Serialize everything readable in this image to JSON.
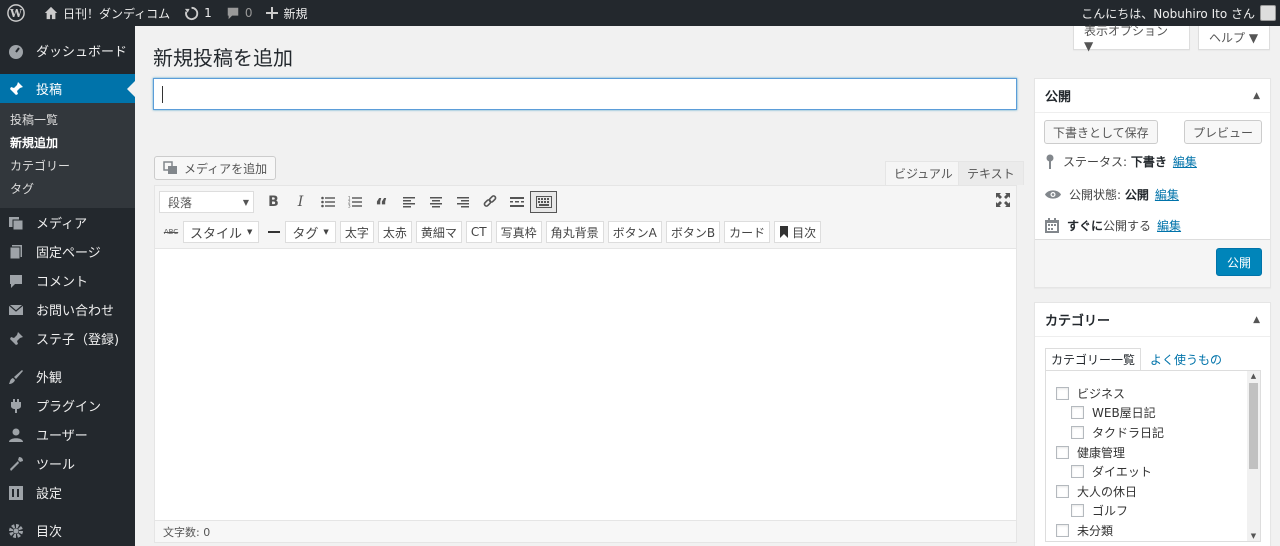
{
  "adminbar": {
    "site_name": "日刊！ダンディコム",
    "updates_count": "1",
    "comments_count": "0",
    "new_label": "新規",
    "greeting": "こんにちは、Nobuhiro Ito さん"
  },
  "sidebar": {
    "items": [
      {
        "label": "ダッシュボード",
        "icon": "dashboard-icon"
      },
      {
        "label": "投稿",
        "icon": "pin-icon"
      },
      {
        "label": "メディア",
        "icon": "media-icon"
      },
      {
        "label": "固定ページ",
        "icon": "page-icon"
      },
      {
        "label": "コメント",
        "icon": "comment-icon"
      },
      {
        "label": "お問い合わせ",
        "icon": "mail-icon"
      },
      {
        "label": "ステ子（登録)",
        "icon": "pin-icon"
      },
      {
        "label": "外観",
        "icon": "brush-icon"
      },
      {
        "label": "プラグイン",
        "icon": "plugin-icon"
      },
      {
        "label": "ユーザー",
        "icon": "user-icon"
      },
      {
        "label": "ツール",
        "icon": "wrench-icon"
      },
      {
        "label": "設定",
        "icon": "settings-icon"
      },
      {
        "label": "目次",
        "icon": "gear-icon"
      }
    ],
    "submenu": [
      "投稿一覧",
      "新規追加",
      "カテゴリー",
      "タグ"
    ]
  },
  "screen_options": "表示オプション ▼",
  "help": "ヘルプ ▼",
  "page_title": "新規投稿を追加",
  "post_title_value": "",
  "media_button": "メディアを追加",
  "editor_tabs": {
    "visual": "ビジュアル",
    "text": "テキスト"
  },
  "toolbar": {
    "format": "段落",
    "style": "スタイル",
    "tag": "タグ",
    "buttons": [
      "太字",
      "太赤",
      "黄細マ",
      "CT",
      "写真枠",
      "角丸背景",
      "ボタンA",
      "ボタンB",
      "カード",
      "目次"
    ]
  },
  "word_count": "文字数: 0",
  "publish_box": {
    "title": "公開",
    "save_draft": "下書きとして保存",
    "preview": "プレビュー",
    "status_label": "ステータス:",
    "status_value": "下書き",
    "visibility_label": "公開状態:",
    "visibility_value": "公開",
    "schedule_bold": "すぐに",
    "schedule_text": "公開する",
    "edit": "編集",
    "publish": "公開"
  },
  "category_box": {
    "title": "カテゴリー",
    "tab_all": "カテゴリー一覧",
    "tab_popular": "よく使うもの",
    "items": [
      {
        "label": "ビジネス",
        "level": 0
      },
      {
        "label": "WEB屋日記",
        "level": 1
      },
      {
        "label": "タクドラ日記",
        "level": 1
      },
      {
        "label": "健康管理",
        "level": 0
      },
      {
        "label": "ダイエット",
        "level": 1
      },
      {
        "label": "大人の休日",
        "level": 0
      },
      {
        "label": "ゴルフ",
        "level": 1
      },
      {
        "label": "未分類",
        "level": 0
      }
    ]
  },
  "colors": {
    "accent": "#0073aa",
    "adminbar": "#23282d",
    "publish": "#0085ba"
  }
}
